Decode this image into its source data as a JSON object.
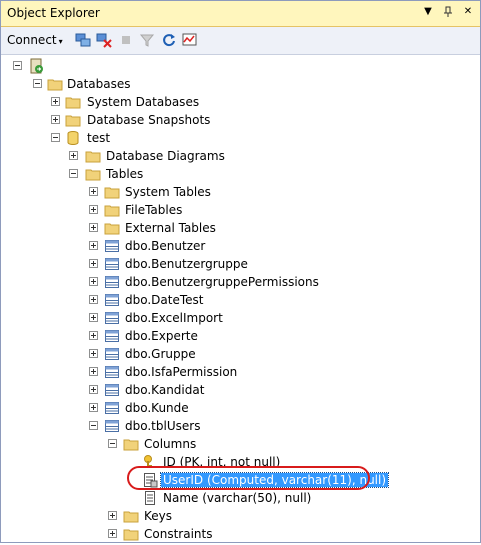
{
  "window": {
    "title": "Object Explorer"
  },
  "toolbar": {
    "connect_label": "Connect",
    "caret": "▾"
  },
  "tree": {
    "databases": "Databases",
    "system_databases": "System Databases",
    "database_snapshots": "Database Snapshots",
    "db_test": "test",
    "database_diagrams": "Database Diagrams",
    "tables": "Tables",
    "system_tables": "System Tables",
    "file_tables": "FileTables",
    "external_tables": "External Tables",
    "table_items": [
      "dbo.Benutzer",
      "dbo.Benutzergruppe",
      "dbo.BenutzergruppePermissions",
      "dbo.DateTest",
      "dbo.ExcelImport",
      "dbo.Experte",
      "dbo.Gruppe",
      "dbo.IsfaPermission",
      "dbo.Kandidat",
      "dbo.Kunde",
      "dbo.tblUsers"
    ],
    "columns": "Columns",
    "column_items": [
      "ID (PK, int, not null)",
      "UserID (Computed, varchar(11), null)",
      "Name (varchar(50), null)"
    ],
    "keys": "Keys",
    "constraints": "Constraints"
  },
  "colors": {
    "title_bg": "#fff6bd",
    "selection": "#3399ff",
    "highlight_ring": "#d81b1b"
  }
}
